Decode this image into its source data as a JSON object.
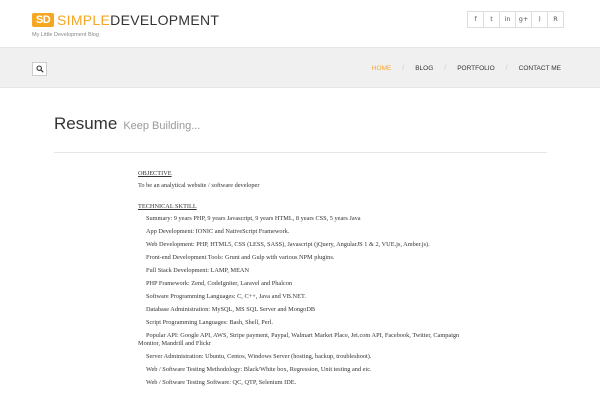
{
  "header": {
    "logo_mark": "SD",
    "logo_simple": "SIMPLE",
    "logo_dev": "DEVELOPMENT",
    "tagline": "My Little Development Blog"
  },
  "social": [
    {
      "icon": "facebook-icon",
      "glyph": "f"
    },
    {
      "icon": "twitter-icon",
      "glyph": "t"
    },
    {
      "icon": "linkedin-icon",
      "glyph": "in"
    },
    {
      "icon": "google-plus-icon",
      "glyph": "g+"
    },
    {
      "icon": "rss-icon",
      "glyph": ")"
    },
    {
      "icon": "resume-icon",
      "glyph": "R"
    }
  ],
  "nav": {
    "items": [
      "HOME",
      "BLOG",
      "PORTFOLIO",
      "CONTACT ME"
    ],
    "active": "HOME"
  },
  "page": {
    "title": "Resume",
    "subtitle": "Keep Building..."
  },
  "resume": {
    "objective_heading": "OBJECTIVE",
    "objective_text": "To be an analytical website / software developer",
    "skills_heading": "TECHNICAL SKTILL",
    "skills": [
      "Summary: 9 years PHP, 9 years Javascript, 9 years HTML, 8 years CSS, 5 years Java",
      "App Development: IONIC and NativeScript Framework.",
      "Web Development: PHP, HTML5, CSS (LESS, SASS), Javascript (jQuery, AngularJS 1 & 2, VUE.js, Amber.js).",
      "Front-end Development Tools: Grunt and Gulp with various NPM plugins.",
      "Full Stack Development: LAMP, MEAN",
      "PHP Framework: Zend, CodeIgniter, Laravel and Phalcon",
      "Software Programming Languages: C, C++, Java and VB.NET.",
      "Database Administration: MySQL, MS SQL Server and MongoDB",
      "Script Programming Languages: Bash, Shell, Perl.",
      "Popular API: Google API, AWS, Stripe payment, Paypal, Walmart Market Place, Jet.com API, Facebook, Twitter, Campaign Monitor, Mandrill and Flickr",
      "Server Administration: Ubuntu, Centos, Windows Server (hosting, backup, troubleshoot).",
      "Web / Software Testing Methodology: Black/White box, Regression, Unit testing and etc.",
      "Web / Software Testing Software: QC, QTP, Selenium IDE."
    ]
  },
  "colors": {
    "accent": "#f5a623",
    "navbar_bg": "#f0f0f0"
  }
}
